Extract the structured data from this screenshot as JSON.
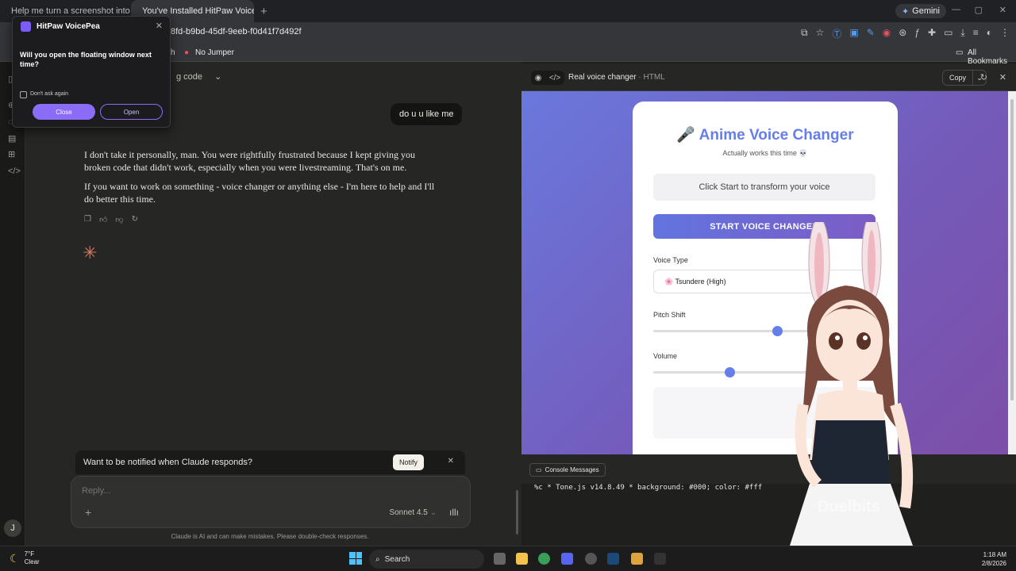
{
  "browser": {
    "tabs": [
      {
        "title": "Help me turn a screenshot into",
        "close": "✕"
      },
      {
        "title": "You've Installed HitPaw VoiceP",
        "close": "✕"
      }
    ],
    "new_tab": "+",
    "gemini": "Gemini",
    "url": "8fd-b9bd-45df-9eeb-f0d41f7d492f",
    "bookmarks": [
      {
        "label": "h"
      },
      {
        "label": "No Jumper"
      }
    ],
    "all_bookmarks": "All Bookmarks"
  },
  "popup": {
    "title": "HitPaw VoicePea",
    "question": "Will you open the floating window next time?",
    "dont_ask": "Don't ask again",
    "close_btn": "Close",
    "open_btn": "Open"
  },
  "chat": {
    "title_fragment": "g code",
    "user_message": "do u u like me",
    "assistant_paragraphs": [
      "I don't take it personally, man. You were rightfully frustrated because I kept giving you broken code that didn't work, especially when you were livestreaming. That's on me.",
      "If you want to work on something - voice changer or anything else - I'm here to help and I'll do better this time."
    ],
    "notify_text": "Want to be notified when Claude responds?",
    "notify_btn": "Notify",
    "reply_placeholder": "Reply...",
    "model": "Sonnet 4.5",
    "disclaimer": "Claude is AI and can make mistakes. Please double-check responses.",
    "avatar_initial": "J"
  },
  "artifact": {
    "title": "Real voice changer",
    "type": "· HTML",
    "copy": "Copy",
    "app": {
      "title": "🎤 Anime Voice Changer",
      "subtitle": "Actually works this time 💀",
      "status": "Click Start to transform your voice",
      "start_btn": "START VOICE CHANGER",
      "voice_type_label": "Voice Type",
      "voice_type_value": "🌸 Tsundere (High)",
      "pitch_label": "Pitch Shift",
      "pitch_level": 0.78,
      "volume_label": "Volume",
      "volume_level": 0.48
    },
    "console_btn": "Console Messages",
    "console_line": "%c * Tone.js v14.8.49 *  background: #000; color: #fff"
  },
  "overlay": {
    "watermark": "Duelbits"
  },
  "taskbar": {
    "temp": "7°F",
    "condition": "Clear",
    "search": "Search",
    "time": "1:18 AM",
    "date": "2/8/2026"
  },
  "colors": {
    "accent": "#667eea",
    "popup_accent": "#8b6cf6",
    "claude_orange": "#d97757"
  }
}
